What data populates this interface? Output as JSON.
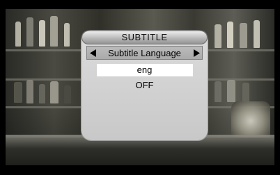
{
  "osd": {
    "title": "SUBTITLE",
    "setting_label": "Subtitle Language",
    "options": [
      {
        "label": "eng",
        "selected": true
      },
      {
        "label": "OFF",
        "selected": false
      }
    ]
  },
  "icons": {
    "left": "triangle-left-icon",
    "right": "triangle-right-icon"
  },
  "colors": {
    "panel": "#d0d0d0",
    "selected_bg": "#ffffff",
    "text": "#000000"
  }
}
